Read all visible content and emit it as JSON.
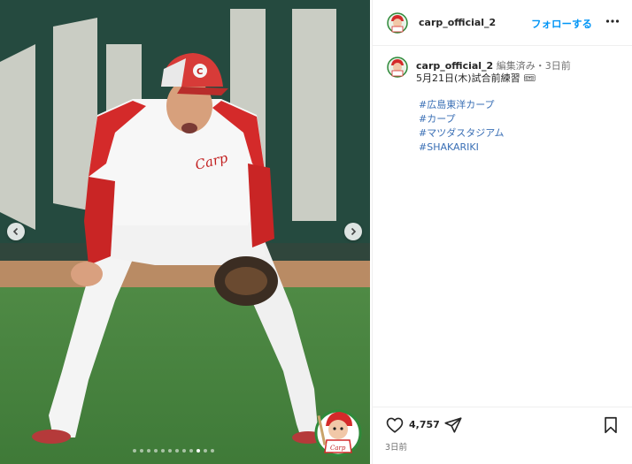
{
  "post": {
    "image_alt": "",
    "carousel": {
      "dot_count": 12,
      "active_index": 9
    }
  },
  "header": {
    "username": "carp_official_2",
    "follow_label": "フォローする",
    "more_icon": "more-horizontal-icon"
  },
  "caption": {
    "username": "carp_official_2",
    "meta": "編集済み・3日前",
    "text": "5月21日(木)試合前練習 🎟",
    "hashtags": [
      "#広島東洋カープ",
      "#カープ",
      "#マツダスタジアム",
      "#SHAKARIKI"
    ]
  },
  "actions": {
    "like_count": "4,757",
    "time": "3日前"
  },
  "colors": {
    "link": "#3a6fb5",
    "follow": "#0095f6",
    "carp_red": "#d42a2a"
  }
}
